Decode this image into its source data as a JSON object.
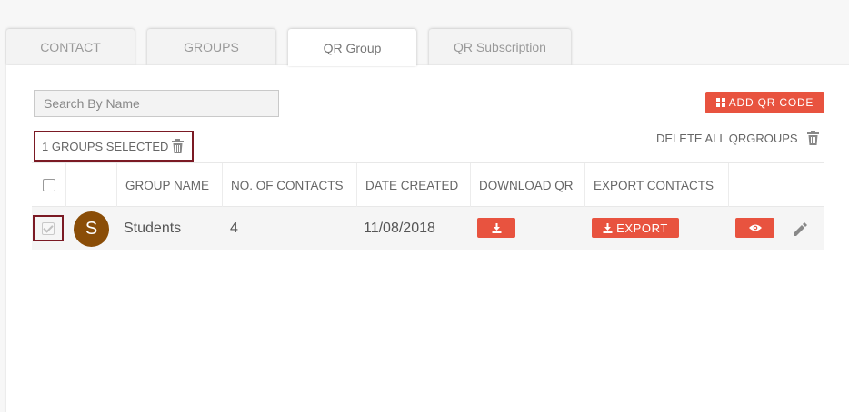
{
  "tabs": [
    {
      "label": "CONTACT",
      "active": false
    },
    {
      "label": "GROUPS",
      "active": false
    },
    {
      "label": "QR Group",
      "active": true
    },
    {
      "label": "QR Subscription",
      "active": false
    }
  ],
  "search": {
    "placeholder": "Search By Name",
    "value": ""
  },
  "toolbar": {
    "add_qr_label": "ADD QR CODE",
    "selected_label": "1 GROUPS SELECTED",
    "delete_all_label": "DELETE ALL QRGROUPS"
  },
  "table": {
    "headers": [
      "GROUP NAME",
      "NO. OF CONTACTS",
      "DATE CREATED",
      "DOWNLOAD QR",
      "EXPORT CONTACTS"
    ],
    "rows": [
      {
        "checked": true,
        "avatar_letter": "S",
        "avatar_color": "#8a4d07",
        "group_name": "Students",
        "contacts": "4",
        "date_created": "11/08/2018",
        "export_label": "EXPORT"
      }
    ]
  },
  "colors": {
    "accent": "#e8533f",
    "highlight_border": "#7b1a24"
  },
  "icons": [
    "grid-icon",
    "trash-icon",
    "download-icon",
    "eye-icon",
    "pencil-icon",
    "checkbox-icon"
  ]
}
